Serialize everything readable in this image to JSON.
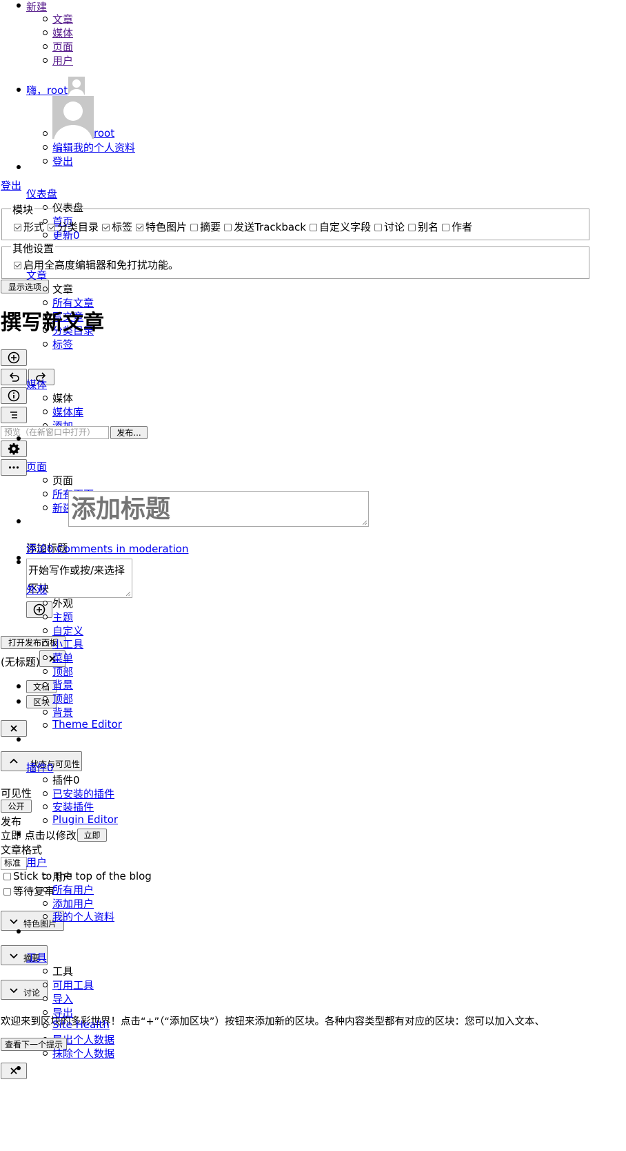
{
  "adminbar": {
    "new": {
      "label": "新建",
      "items": [
        "文章",
        "媒体",
        "页面",
        "用户"
      ]
    },
    "account": {
      "greeting": "嗨，root",
      "items": [
        "root",
        "编辑我的个人资料",
        "登出"
      ]
    },
    "logout": "登出"
  },
  "menu": {
    "dashboard": {
      "label": "仪表盘",
      "items": [
        "仪表盘",
        "首页",
        "更新0"
      ]
    },
    "posts": {
      "label": "文章",
      "items": [
        "文章",
        "所有文章",
        "写文章",
        "分类目录",
        "标签"
      ]
    },
    "media": {
      "label": "媒体",
      "items": [
        "媒体",
        "媒体库",
        "添加"
      ]
    },
    "pages": {
      "label": "页面",
      "items": [
        "页面",
        "所有页面",
        "新建页面"
      ]
    },
    "comments": {
      "label": "评论0 Comments in moderation"
    },
    "appearance": {
      "label": "外观",
      "items": [
        "外观",
        "主题",
        "自定义",
        "小工具",
        "菜单",
        "顶部",
        "背景",
        "顶部",
        "背景",
        "Theme Editor"
      ]
    },
    "plugins": {
      "label": "插件0",
      "items": [
        "插件0",
        "已安装的插件",
        "安装插件",
        "Plugin Editor"
      ]
    },
    "users": {
      "label": "用户",
      "items": [
        "用户",
        "所有用户",
        "添加用户",
        "我的个人资料"
      ]
    },
    "tools": {
      "label": "工具",
      "items": [
        "工具",
        "可用工具",
        "导入",
        "导出",
        "Site Health",
        "导出个人数据",
        "抹除个人数据"
      ]
    }
  },
  "screen_options": {
    "modules_legend": "模块",
    "modules": [
      {
        "label": "形式",
        "checked": true
      },
      {
        "label": "分类目录",
        "checked": true
      },
      {
        "label": "标签",
        "checked": true
      },
      {
        "label": "特色图片",
        "checked": true
      },
      {
        "label": "摘要",
        "checked": false
      },
      {
        "label": "发送Trackback",
        "checked": false
      },
      {
        "label": "自定义字段",
        "checked": false
      },
      {
        "label": "讨论",
        "checked": false
      },
      {
        "label": "别名",
        "checked": false
      },
      {
        "label": "作者",
        "checked": false
      }
    ],
    "other_legend": "其他设置",
    "fullheight_label": "启用全高度编辑器和免打扰功能。",
    "show_button": "显示选项"
  },
  "editor": {
    "heading": "撰写新文章",
    "preview": "预览（在新窗口中打开）",
    "publish": "发布...",
    "title_placeholder": "添加标题",
    "add_title_label": "添加标题",
    "body_placeholder": "开始写作或按/来选择区块",
    "open_publish_panel": "打开发布面板",
    "untitled": "(无标题)",
    "tab_document": "文档",
    "tab_block": "区块",
    "status_visibility_toggle": "状态与可见性",
    "visibility_label": "可见性",
    "visibility_value": "公开",
    "publish_label": "发布",
    "publish_when": "立即 点击以修改",
    "publish_when_btn": "立即",
    "format_label": "文章格式",
    "format_value": "标准",
    "stick_label": "Stick to the top of the blog",
    "pending_label": "等待复审",
    "featured_image": "特色图片",
    "excerpt": "摘要",
    "discussion": "讨论",
    "welcome_text": "欢迎来到区块的多彩世界！点击“+”（“添加区块”）按钮来添加新的区块。各种内容类型都有对应的区块：您可以加入文本、",
    "next_tip": "查看下一个提示"
  }
}
